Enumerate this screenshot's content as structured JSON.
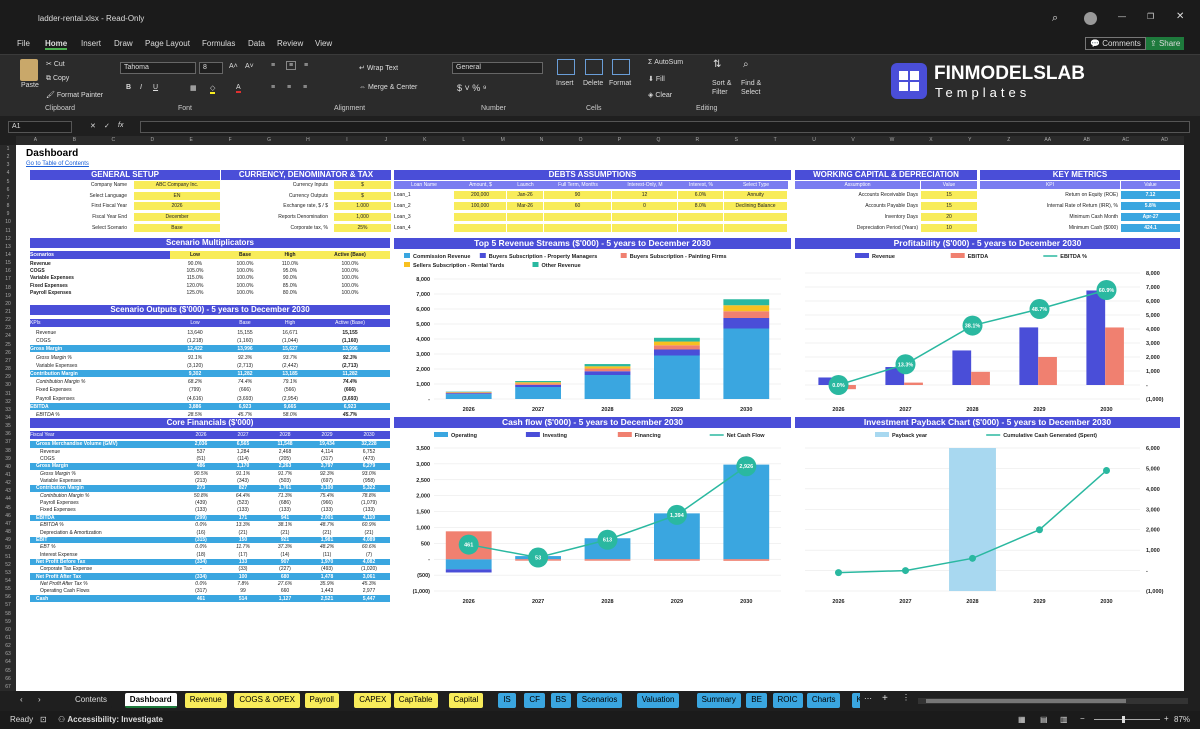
{
  "window": {
    "title": "ladder-rental.xlsx  -  Read-Only"
  },
  "menu": [
    "File",
    "Home",
    "Insert",
    "Draw",
    "Page Layout",
    "Formulas",
    "Data",
    "Review",
    "View"
  ],
  "menu_right": {
    "comments": "Comments",
    "share": "Share"
  },
  "ribbon": {
    "paste": "Paste",
    "cut": "Cut",
    "copy": "Copy",
    "format_painter": "Format Painter",
    "clipboard": "Clipboard",
    "font_name": "Tahoma",
    "font_size": "8",
    "font": "Font",
    "wrap": "Wrap Text",
    "merge": "Merge & Center",
    "alignment": "Alignment",
    "number_format": "General",
    "number": "Number",
    "insert": "Insert",
    "delete": "Delete",
    "format": "Format",
    "cells": "Cells",
    "autosum": "AutoSum",
    "fill": "Fill",
    "clear": "Clear",
    "sort": "Sort & Filter",
    "find": "Find & Select",
    "editing": "Editing",
    "logo_main": "FINMODELSLAB",
    "logo_sub": "Templates"
  },
  "formula_bar": {
    "name_box": "A1",
    "fx": "fx"
  },
  "columns": [
    "A",
    "B",
    "C",
    "D",
    "E",
    "F",
    "G",
    "H",
    "I",
    "J",
    "K",
    "L",
    "M",
    "N",
    "O",
    "P",
    "Q",
    "R",
    "S",
    "T",
    "U",
    "V",
    "W",
    "X",
    "Y",
    "Z",
    "AA",
    "AB",
    "AC",
    "AD"
  ],
  "sheet": {
    "title": "Dashboard",
    "link": "Go to Table of Contents",
    "general_setup": {
      "title": "GENERAL SETUP",
      "rows": [
        [
          "Company Name",
          "ABC Company Inc."
        ],
        [
          "Select Language",
          "EN"
        ],
        [
          "First Fiscal Year",
          "2026"
        ],
        [
          "Fiscal Year End",
          "December"
        ],
        [
          "Select Scenario",
          "Base"
        ]
      ]
    },
    "currency": {
      "title": "CURRENCY, DENOMINATOR & TAX",
      "rows": [
        [
          "Currency Inputs",
          "$"
        ],
        [
          "Currency Outputs",
          "$"
        ],
        [
          "Exchange rate, $ / $",
          "1.000"
        ],
        [
          "Reports Denomination",
          "1,000"
        ],
        [
          "Corporate tax, %",
          "25%"
        ]
      ]
    },
    "debts": {
      "title": "DEBTS ASSUMPTIONS",
      "headers": [
        "Loan Name",
        "Amount, $",
        "Launch",
        "Full Term, Months",
        "Interest-Only, M",
        "Interest, %",
        "Select Type"
      ],
      "rows": [
        [
          "Loan_1",
          "200,000",
          "Jan-26",
          "90",
          "12",
          "6.0%",
          "Annuity"
        ],
        [
          "Loan_2",
          "100,000",
          "Mar-26",
          "60",
          "0",
          "8.0%",
          "Declining Balance"
        ],
        [
          "Loan_3",
          "",
          "",
          "",
          "",
          "",
          ""
        ],
        [
          "Loan_4",
          "",
          "",
          "",
          "",
          "",
          ""
        ]
      ]
    },
    "wc": {
      "title": "WORKING CAPITAL & DEPRECIATION",
      "headers": [
        "Assumption",
        "Value"
      ],
      "rows": [
        [
          "Accounts Receivable Days",
          "15"
        ],
        [
          "Accounts Payable Days",
          "15"
        ],
        [
          "Inventory Days",
          "20"
        ],
        [
          "Depreciation Period (Years)",
          "10"
        ]
      ]
    },
    "kpi": {
      "title": "KEY METRICS",
      "headers": [
        "KPI",
        "Value"
      ],
      "rows": [
        [
          "Return on Equity (ROE)",
          "7.12"
        ],
        [
          "Internal Rate of Return (IRR), %",
          "5.8%"
        ],
        [
          "Minimum Cash Month",
          "Apr-27"
        ],
        [
          "Minimum Cash ($000)",
          "424.1"
        ]
      ]
    },
    "multipliers": {
      "title": "Scenario Multiplicators",
      "headers": [
        "Scenarios",
        "Low",
        "Base",
        "High",
        "Active (Base)"
      ],
      "rows": [
        [
          "Revenue",
          "90.0%",
          "100.0%",
          "110.0%",
          "100.0%"
        ],
        [
          "COGS",
          "105.0%",
          "100.0%",
          "95.0%",
          "100.0%"
        ],
        [
          "Variable Expenses",
          "115.0%",
          "100.0%",
          "90.0%",
          "100.0%"
        ],
        [
          "Fixed Expenses",
          "120.0%",
          "100.0%",
          "85.0%",
          "100.0%"
        ],
        [
          "Payroll Expenses",
          "125.0%",
          "100.0%",
          "80.0%",
          "100.0%"
        ]
      ]
    },
    "outputs": {
      "title": "Scenario Outputs ($'000) - 5 years to December 2030",
      "headers": [
        "KPIs",
        "Low",
        "Base",
        "High",
        "Active (Base)"
      ],
      "rows": [
        [
          "Revenue",
          "13,640",
          "15,155",
          "16,671",
          "15,155",
          ""
        ],
        [
          "COGS",
          "(1,218)",
          "(1,160)",
          "(1,044)",
          "(1,160)",
          ""
        ],
        [
          "Gross Margin",
          "12,422",
          "13,996",
          "15,627",
          "13,996",
          "h"
        ],
        [
          "Gross Margin %",
          "91.1%",
          "92.3%",
          "93.7%",
          "92.3%",
          "i"
        ],
        [
          "Variable Expenses",
          "(3,120)",
          "(2,713)",
          "(2,442)",
          "(2,713)",
          ""
        ],
        [
          "Contribution Margin",
          "9,302",
          "11,282",
          "13,185",
          "11,282",
          "h"
        ],
        [
          "Contribution Margin %",
          "68.2%",
          "74.4%",
          "79.1%",
          "74.4%",
          "i"
        ],
        [
          "Fixed Expenses",
          "(799)",
          "(666)",
          "(566)",
          "(666)",
          ""
        ],
        [
          "Payroll Expenses",
          "(4,616)",
          "(3,693)",
          "(2,954)",
          "(3,693)",
          ""
        ],
        [
          "EBITDA",
          "3,886",
          "6,923",
          "9,665",
          "6,923",
          "h"
        ],
        [
          "EBITDA %",
          "28.5%",
          "45.7%",
          "58.0%",
          "45.7%",
          "i"
        ]
      ]
    },
    "core": {
      "title": "Core Financials ($'000)",
      "headers": [
        "Fiscal Year",
        "2026",
        "2027",
        "2028",
        "2029",
        "2030"
      ],
      "rows": [
        [
          "Gross Merchandise Volume (GMV)",
          "2,036",
          "6,565",
          "11,548",
          "19,434",
          "32,228",
          "h"
        ],
        [
          "Revenue",
          "537",
          "1,284",
          "2,468",
          "4,114",
          "6,752",
          ""
        ],
        [
          "COGS",
          "(51)",
          "(114)",
          "(205)",
          "(317)",
          "(473)",
          ""
        ],
        [
          "Gross Margin",
          "486",
          "1,170",
          "2,263",
          "3,797",
          "6,279",
          "h"
        ],
        [
          "Gross Margin %",
          "90.5%",
          "91.1%",
          "91.7%",
          "92.3%",
          "93.0%",
          "i"
        ],
        [
          "Variable Expenses",
          "(213)",
          "(343)",
          "(503)",
          "(697)",
          "(958)",
          ""
        ],
        [
          "Contribution Margin",
          "273",
          "827",
          "1,761",
          "3,100",
          "5,322",
          "h"
        ],
        [
          "Contribution Margin %",
          "50.8%",
          "64.4%",
          "71.3%",
          "75.4%",
          "78.8%",
          "i"
        ],
        [
          "Payroll Expenses",
          "(439)",
          "(523)",
          "(686)",
          "(966)",
          "(1,079)",
          ""
        ],
        [
          "Fixed Expenses",
          "(133)",
          "(133)",
          "(133)",
          "(133)",
          "(133)",
          ""
        ],
        [
          "EBITDA",
          "(299)",
          "171",
          "941",
          "2,001",
          "4,110",
          "h"
        ],
        [
          "EBITDA %",
          "0.0%",
          "13.3%",
          "38.1%",
          "48.7%",
          "60.9%",
          "i"
        ],
        [
          "Depreciation & Amortization",
          "(16)",
          "(21)",
          "(21)",
          "(21)",
          "(21)",
          ""
        ],
        [
          "EBIT",
          "(315)",
          "150",
          "921",
          "1,981",
          "4,089",
          "h"
        ],
        [
          "EBT %",
          "0.0%",
          "11.7%",
          "37.3%",
          "48.2%",
          "60.6%",
          "i"
        ],
        [
          "Interest Expense",
          "(18)",
          "(17)",
          "(14)",
          "(11)",
          "(7)",
          ""
        ],
        [
          "Net Profit Before Tax",
          "(334)",
          "133",
          "907",
          "1,970",
          "4,082",
          "h"
        ],
        [
          "Corporate Tax Expense",
          "-",
          "(33)",
          "(227)",
          "(493)",
          "(1,020)",
          ""
        ],
        [
          "Net Profit After Tax",
          "(334)",
          "100",
          "680",
          "1,478",
          "3,061",
          "h"
        ],
        [
          "Net Profit After Tax %",
          "0.0%",
          "7.8%",
          "27.6%",
          "35.9%",
          "45.3%",
          "i"
        ],
        [
          "Operating Cash Flows",
          "(317)",
          "99",
          "660",
          "1,443",
          "2,977",
          ""
        ],
        [
          "Cash",
          "461",
          "514",
          "1,127",
          "2,521",
          "5,447",
          "h"
        ]
      ]
    }
  },
  "chart_data": [
    {
      "type": "bar",
      "title": "Top 5 Revenue Streams ($'000) - 5 years to December 2030",
      "categories": [
        "2026",
        "2027",
        "2028",
        "2029",
        "2030"
      ],
      "ylim": [
        0,
        8000
      ],
      "yticks": [
        "8,000",
        "7,000",
        "6,000",
        "5,000",
        "4,000",
        "3,000",
        "2,000",
        "1,000",
        "-"
      ],
      "series": [
        {
          "name": "Commission Revenue",
          "color": "#3aa6e0",
          "values": [
            330,
            800,
            1600,
            2900,
            4700
          ]
        },
        {
          "name": "Buyers Subscription - Property Managers",
          "color": "#4a4ed8",
          "values": [
            60,
            140,
            250,
            400,
            700
          ]
        },
        {
          "name": "Buyers Subscription - Painting Firms",
          "color": "#f08070",
          "values": [
            40,
            100,
            180,
            280,
            450
          ]
        },
        {
          "name": "Sellers Subscription - Rental Yards",
          "color": "#f8c020",
          "values": [
            30,
            80,
            150,
            250,
            400
          ]
        },
        {
          "name": "Other Revenue",
          "color": "#2ab8a0",
          "values": [
            30,
            80,
            150,
            250,
            400
          ]
        }
      ]
    },
    {
      "type": "bar",
      "title": "Profitability ($'000) - 5 years to December 2030",
      "categories": [
        "2026",
        "2027",
        "2028",
        "2029",
        "2030"
      ],
      "ylim": [
        -1000,
        8000
      ],
      "yticks": [
        "8,000",
        "7,000",
        "6,000",
        "5,000",
        "4,000",
        "3,000",
        "2,000",
        "1,000",
        "-",
        "(1,000)"
      ],
      "series": [
        {
          "name": "Revenue",
          "color": "#4a4ed8",
          "values": [
            537,
            1284,
            2468,
            4114,
            6752
          ]
        },
        {
          "name": "EBITDA",
          "color": "#f08070",
          "values": [
            -299,
            171,
            941,
            2001,
            4110
          ]
        },
        {
          "name": "EBITDA %",
          "color": "#2ab8a0",
          "values": [
            0.0,
            13.3,
            38.1,
            48.7,
            60.9
          ],
          "labels": [
            "0.0%",
            "13.3%",
            "38.1%",
            "48.7%",
            "60.9%"
          ]
        }
      ]
    },
    {
      "type": "bar",
      "title": "Cash flow ($'000) - 5 years to December 2030",
      "categories": [
        "2026",
        "2027",
        "2028",
        "2029",
        "2030"
      ],
      "ylim": [
        -1000,
        3500
      ],
      "yticks": [
        "3,500",
        "3,000",
        "2,500",
        "2,000",
        "1,500",
        "1,000",
        "500",
        "-",
        "(500)",
        "(1,000)"
      ],
      "series": [
        {
          "name": "Operating",
          "color": "#3aa6e0",
          "values": [
            -317,
            99,
            660,
            1443,
            2977
          ]
        },
        {
          "name": "Investing",
          "color": "#4a4ed8",
          "values": [
            -100,
            0,
            0,
            0,
            0
          ]
        },
        {
          "name": "Financing",
          "color": "#f08070",
          "values": [
            878,
            -46,
            -47,
            -49,
            -51
          ]
        },
        {
          "name": "Net Cash Flow",
          "color": "#2ab8a0",
          "values": [
            461,
            53,
            613,
            1394,
            2926
          ],
          "labels": [
            "461",
            "53",
            "613",
            "1,394",
            "2,926"
          ]
        }
      ]
    },
    {
      "type": "line",
      "title": "Investment Payback Chart ($'000) - 5 years to December 2030",
      "categories": [
        "2026",
        "2027",
        "2028",
        "2029",
        "2030"
      ],
      "ylim": [
        -1000,
        6000
      ],
      "yticks": [
        "6,000",
        "5,000",
        "4,000",
        "3,000",
        "2,000",
        "1,000",
        "-",
        "(1,000)"
      ],
      "series": [
        {
          "name": "Payback year",
          "color": "#a8d8f0",
          "values": [
            0,
            0,
            1,
            0,
            0
          ]
        },
        {
          "name": "Cumulative Cash Generated (Spent)",
          "color": "#2ab8a0",
          "values": [
            -100,
            0,
            600,
            2000,
            4900
          ]
        }
      ]
    }
  ],
  "tabs": [
    {
      "l": "Contents",
      "c": "#1f1f1f",
      "f": "#ddd"
    },
    {
      "l": "Dashboard",
      "c": "#ffffff",
      "f": "#000"
    },
    {
      "l": "Revenue",
      "c": "#f8ec5a",
      "f": "#000"
    },
    {
      "l": "COGS & OPEX",
      "c": "#f8ec5a",
      "f": "#000"
    },
    {
      "l": "Payroll",
      "c": "#f8ec5a",
      "f": "#000"
    },
    {
      "l": "CAPEX",
      "c": "#f8ec5a",
      "f": "#000"
    },
    {
      "l": "CapTable",
      "c": "#f8ec5a",
      "f": "#000"
    },
    {
      "l": "Capital",
      "c": "#f8ec5a",
      "f": "#000"
    },
    {
      "l": "IS",
      "c": "#3aa6e0",
      "f": "#000"
    },
    {
      "l": "CF",
      "c": "#3aa6e0",
      "f": "#000"
    },
    {
      "l": "BS",
      "c": "#3aa6e0",
      "f": "#000"
    },
    {
      "l": "Scenarios",
      "c": "#3aa6e0",
      "f": "#000"
    },
    {
      "l": "Valuation",
      "c": "#3aa6e0",
      "f": "#000"
    },
    {
      "l": "Summary",
      "c": "#3aa6e0",
      "f": "#000"
    },
    {
      "l": "BE",
      "c": "#3aa6e0",
      "f": "#000"
    },
    {
      "l": "ROIC",
      "c": "#3aa6e0",
      "f": "#000"
    },
    {
      "l": "Charts",
      "c": "#3aa6e0",
      "f": "#000"
    },
    {
      "l": "KPIs",
      "c": "#3aa6e0",
      "f": "#000"
    },
    {
      "l": "S",
      "c": "#3aa6e0",
      "f": "#000"
    }
  ],
  "status": {
    "ready": "Ready",
    "accessibility": "Accessibility: Investigate",
    "zoom": "87%"
  }
}
